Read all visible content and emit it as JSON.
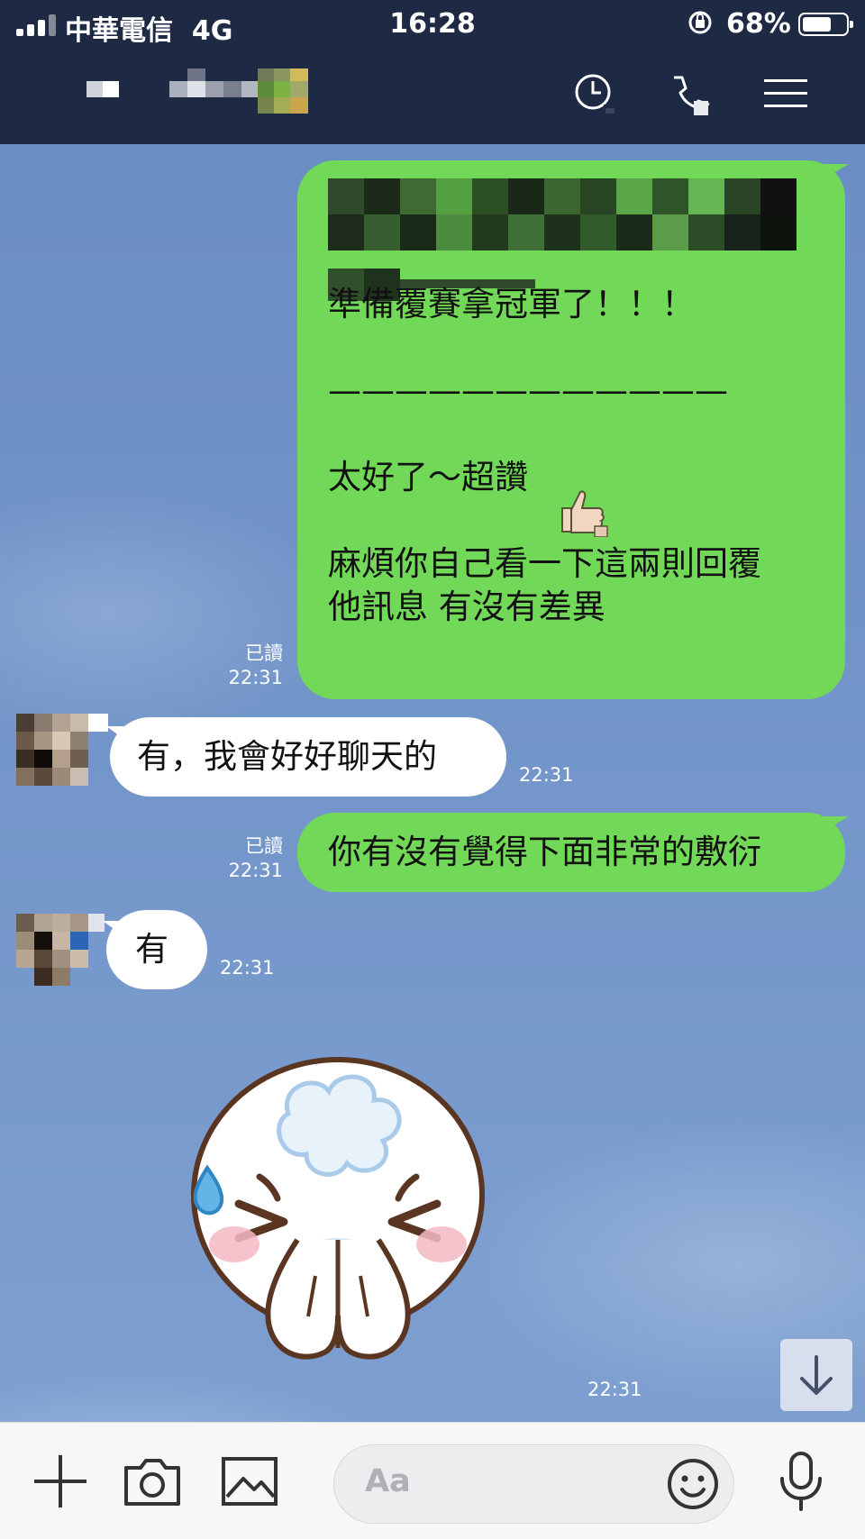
{
  "status_bar": {
    "carrier": "中華電信",
    "network": "4G",
    "time": "16:28",
    "battery_percent": "68%",
    "battery_level": 0.68
  },
  "header": {
    "icons": [
      "clock-icon",
      "phone-icon",
      "menu-icon"
    ]
  },
  "messages": [
    {
      "id": "m1",
      "side": "out",
      "text": "準備覆賽拿冠軍了！！！\n\n————————————\n\n太好了～超讚\n\n麻煩你自己看一下這兩則回覆\n他訊息 有沒有差異",
      "read_label": "已讀",
      "time": "22:31"
    },
    {
      "id": "m2",
      "side": "in",
      "text": "有，我會好好聊天的",
      "time": "22:31"
    },
    {
      "id": "m3",
      "side": "out",
      "text": "你有沒有覺得下面非常的敷衍",
      "read_label": "已讀",
      "time": "22:31"
    },
    {
      "id": "m4",
      "side": "in",
      "text": "有",
      "time": "22:31"
    },
    {
      "id": "m5",
      "side": "in",
      "kind": "sticker",
      "sticker": "sweating-bowing-sticker",
      "time": "22:31"
    }
  ],
  "composer": {
    "placeholder": "Aa",
    "icons": [
      "plus-icon",
      "camera-icon",
      "image-icon",
      "emoji-icon",
      "microphone-icon"
    ]
  },
  "colors": {
    "header": "#1e2a44",
    "outgoing_bubble": "#72d858",
    "incoming_bubble": "#ffffff",
    "chat_background": "#6b8fc4"
  }
}
